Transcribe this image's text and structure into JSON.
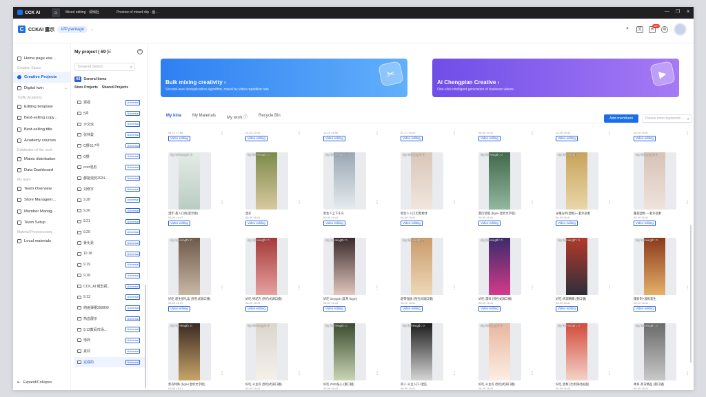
{
  "titlebar": {
    "app_name": "CCK AI",
    "tabs": [
      "Mixed editing · 请稍后",
      "Preview of mixed clip · 画…"
    ],
    "controls": [
      "—",
      "❐",
      "✕"
    ]
  },
  "header": {
    "logo_letter": "C",
    "brand": "CCKAI 露示",
    "vip": "VIP package"
  },
  "sidebar": {
    "items": [
      {
        "type": "item",
        "label": "Home page exe..."
      },
      {
        "type": "section",
        "label": "Creation Space"
      },
      {
        "type": "item",
        "label": "Creative Projects",
        "active": true
      },
      {
        "type": "item",
        "label": "Digital twin"
      },
      {
        "type": "section",
        "label": "Traffic Academy"
      },
      {
        "type": "item",
        "label": "Editing template"
      },
      {
        "type": "item",
        "label": "Best-selling copy..."
      },
      {
        "type": "item",
        "label": "Best-selling title"
      },
      {
        "type": "item",
        "label": "Academy courses"
      },
      {
        "type": "section",
        "label": "Distribution of the work"
      },
      {
        "type": "item",
        "label": "Matrix distribution"
      },
      {
        "type": "item",
        "label": "Data Dashboard"
      },
      {
        "type": "section",
        "label": "My team"
      },
      {
        "type": "item",
        "label": "Team Overview"
      },
      {
        "type": "item",
        "label": "Store Managem..."
      },
      {
        "type": "item",
        "label": "Member Manag..."
      },
      {
        "type": "item",
        "label": "Team Setup"
      },
      {
        "type": "section",
        "label": "Material Preprocessing"
      },
      {
        "type": "item",
        "label": "Local materials"
      }
    ],
    "expand": "Expand/Collapse"
  },
  "projects": {
    "title": "My project ( 69 )",
    "search_placeholder": "Keyword Search",
    "filter_all": "All",
    "filter_general": "General items",
    "filter_store": "Store Projects",
    "filter_shared": "Shared Projects",
    "folders": [
      {
        "name": "源视"
      },
      {
        "name": "5月"
      },
      {
        "name": "沙文炫"
      },
      {
        "name": "张林曼"
      },
      {
        "name": "C野10.7号"
      },
      {
        "name": "C野"
      },
      {
        "name": "ccer混剪"
      },
      {
        "name": "都能混剪2024..."
      },
      {
        "name": "刘修字"
      },
      {
        "name": "9.28"
      },
      {
        "name": "9.26"
      },
      {
        "name": "9.21"
      },
      {
        "name": "9.20"
      },
      {
        "name": "景化素"
      },
      {
        "name": "10.18"
      },
      {
        "name": "9.19"
      },
      {
        "name": "9.18"
      },
      {
        "name": "CCK_AI 帽剪视..."
      },
      {
        "name": "9.13"
      },
      {
        "name": "纯画弹量290800"
      },
      {
        "name": "热血展示"
      },
      {
        "name": "9.12数码市场..."
      },
      {
        "name": "电商"
      },
      {
        "name": "素材"
      },
      {
        "name": "完成的",
        "selected": true
      }
    ],
    "tag": "Universal"
  },
  "banners": [
    {
      "title": "Bulk mixing creativity ›",
      "sub": "Second-level deduplication algorithm, mixed by video repetition rate",
      "icon": "✂"
    },
    {
      "title": "Ai Chengpian Creative ›",
      "sub": "One-click intelligent generation of business videos",
      "icon": "▶"
    }
  ],
  "tabs": [
    "My kina",
    "My Materials",
    "My work ⓘ",
    "Recycle Bin"
  ],
  "add_members": "Add members",
  "search_placeholder": "Please enter keywords...",
  "tag_video": "Video editing",
  "top_row": [
    "04-17 17:58",
    "01-03 13:42",
    "10-16 16:06",
    "01-17 15:23",
    "06-09 10:41",
    "04-25 15:42",
    "06-09 10:47"
  ],
  "len_label": "My full-length: 0",
  "cards": [
    {
      "name": "漫年·基入口请(混示图)",
      "date": "06-09 16:47"
    },
    {
      "name": "混彩",
      "date": "06-09 16:41"
    },
    {
      "name": "新生人上下车车",
      "date": "06-09 16:41"
    },
    {
      "name": "新生人入口无需素材",
      "date": "06-09 16:41"
    },
    {
      "name": "夏历智能 (bgm+混析文字板)",
      "date": "06-09 16:41"
    },
    {
      "name": "录播分析(混框)一套外部素",
      "date": "06-09 16:41"
    },
    {
      "name": "量抱混框·一套外部素",
      "date": "06-09 16:41"
    },
    {
      "name": "好吃·建生部礼盒 (预包式调口播)",
      "date": "06-09 16:41"
    },
    {
      "name": "好吃-纯结方 (预包式调口播)",
      "date": "06-09 16:41"
    },
    {
      "name": "好吃·intrygee (美草+bgm)",
      "date": "06-09 16:41"
    },
    {
      "name": "超零强质 (预包式调口播)",
      "date": "06-09 16:41"
    },
    {
      "name": "好吃·漫料 (预包式调口播)",
      "date": "06-09 16:41"
    },
    {
      "name": "好吃·纯理精细 (重口播)",
      "date": "06-09 16:41"
    },
    {
      "name": "爆剪制+混框套生",
      "date": "06-09 16:41"
    },
    {
      "name": "剪有特殊 (bgm+混析文字板)",
      "date": "06-09 16:41"
    },
    {
      "name": "好吃·公主有 (预包式调口播)",
      "date": "06-09 16:41"
    },
    {
      "name": "好吃·OKE核心 (重口播)",
      "date": "06-09 16:41"
    },
    {
      "name": "简人·公主入口+混匹",
      "date": "06-09 16:41"
    },
    {
      "name": "好吃·公主有 (预包式调口播)",
      "date": "06-09 16:41"
    },
    {
      "name": "好吃·混框 (比例调动画面)",
      "date": "06-09 16:41"
    },
    {
      "name": "帅系·高货精品 (重口播)",
      "date": "06-09 16:41"
    }
  ],
  "thumb_colors": [
    [
      "#e4ece6",
      "#b9ccc4"
    ],
    [
      "#7c8a4a",
      "#d8c9a0"
    ],
    [
      "#9aa7b3",
      "#e6ecef"
    ],
    [
      "#d9c6b8",
      "#f1e6dc"
    ],
    [
      "#3f6a4a",
      "#93b7a0"
    ],
    [
      "#c8a35a",
      "#e9d7a8"
    ],
    [
      "#d7c2b6",
      "#efe3da"
    ],
    [
      "#6e5a4a",
      "#c9b8a6"
    ],
    [
      "#a43a3a",
      "#e8a0a0"
    ],
    [
      "#3a2a2a",
      "#e0c7bf"
    ],
    [
      "#c99c6a",
      "#eed8b9"
    ],
    [
      "#3b2b6b",
      "#d43a8a"
    ],
    [
      "#b33a2a",
      "#2e2e3a"
    ],
    [
      "#8a3a1a",
      "#e6b06a"
    ],
    [
      "#3a2a22",
      "#c7a56a"
    ],
    [
      "#dcd6cc",
      "#f5f1ea"
    ],
    [
      "#3b4a2e",
      "#c8d6b3"
    ],
    [
      "#1c1c1c",
      "#d6d6d6"
    ],
    [
      "#e7b7a0",
      "#fdeee3"
    ],
    [
      "#d24b3b",
      "#f4d3c8"
    ],
    [
      "#6a6a6a",
      "#c9c9c9"
    ]
  ]
}
